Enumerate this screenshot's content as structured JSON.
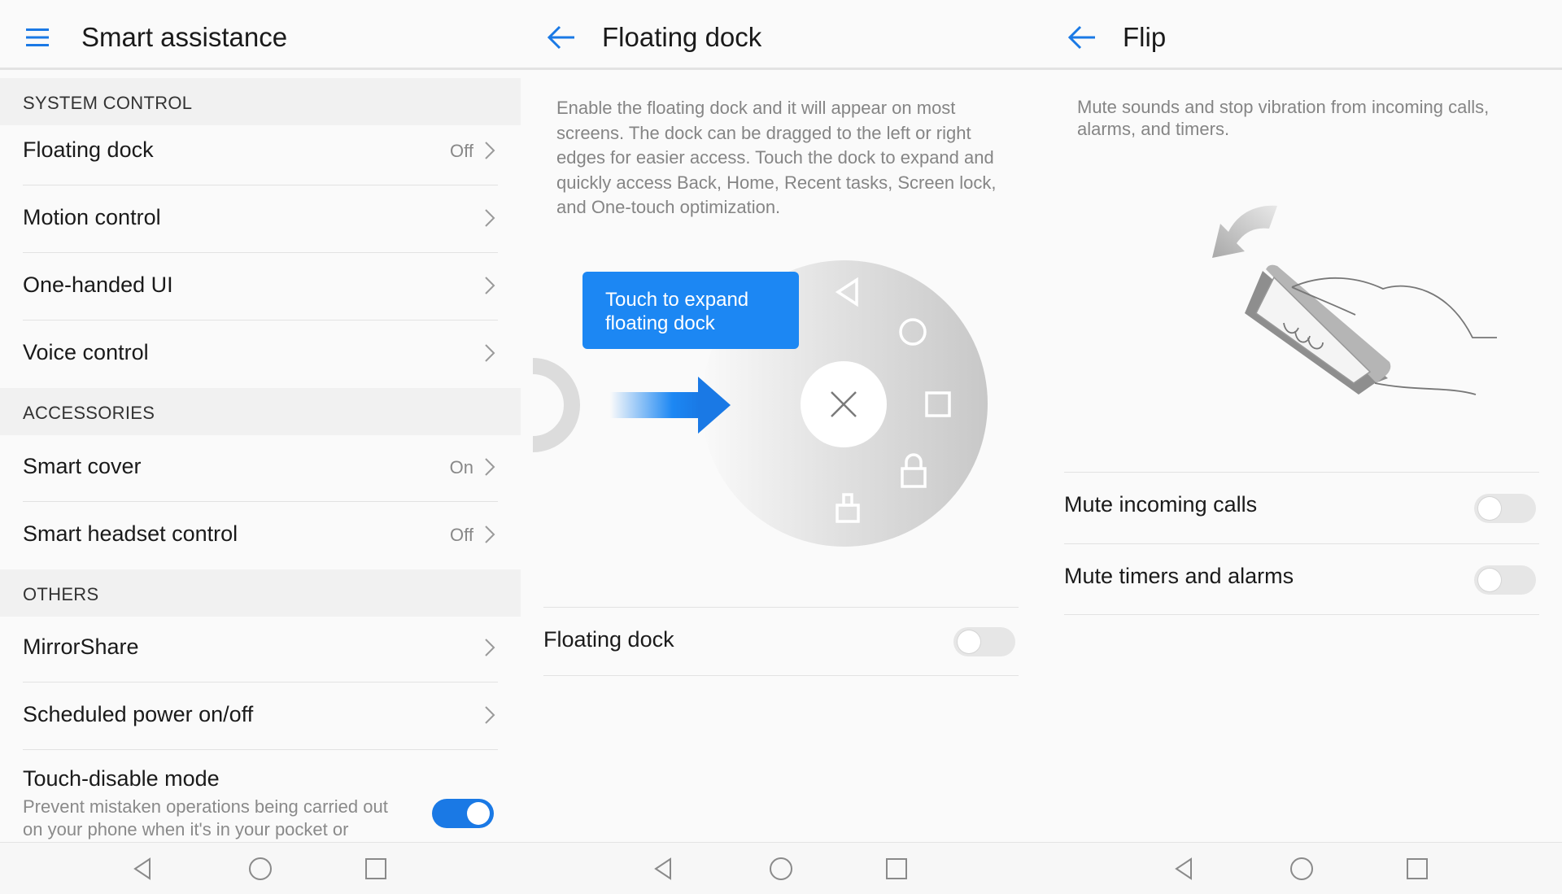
{
  "screen1": {
    "title": "Smart assistance",
    "sections": [
      {
        "header": "SYSTEM CONTROL",
        "items": [
          {
            "label": "Floating dock",
            "value": "Off"
          },
          {
            "label": "Motion control",
            "value": ""
          },
          {
            "label": "One-handed UI",
            "value": ""
          },
          {
            "label": "Voice control",
            "value": ""
          }
        ]
      },
      {
        "header": "ACCESSORIES",
        "items": [
          {
            "label": "Smart cover",
            "value": "On"
          },
          {
            "label": "Smart headset control",
            "value": "Off"
          }
        ]
      },
      {
        "header": "OTHERS",
        "items": [
          {
            "label": "MirrorShare",
            "value": ""
          },
          {
            "label": "Scheduled power on/off",
            "value": ""
          }
        ]
      }
    ],
    "touch_disable": {
      "label": "Touch-disable mode",
      "description": "Prevent mistaken operations being carried out on your phone when it's in your pocket or",
      "enabled": true
    }
  },
  "screen2": {
    "title": "Floating dock",
    "description": "Enable the floating dock and it will appear on most screens. The dock can be dragged to the left or right edges for easier access. Touch the dock to expand and quickly access Back, Home, Recent tasks, Screen lock, and One-touch optimization.",
    "tooltip": "Touch to expand floating dock",
    "setting_label": "Floating dock",
    "setting_enabled": false
  },
  "screen3": {
    "title": "Flip",
    "description": "Mute sounds and stop vibration from incoming calls, alarms, and timers.",
    "settings": [
      {
        "label": "Mute incoming calls",
        "enabled": false
      },
      {
        "label": "Mute timers and alarms",
        "enabled": false
      }
    ]
  },
  "colors": {
    "accent": "#1a79e5",
    "tooltip": "#1c87f3",
    "background": "#fafafa",
    "section_bg": "#f1f1f1"
  },
  "icons": {
    "menu": "hamburger-menu-icon",
    "back": "back-arrow-icon",
    "chevron": "chevron-right-icon",
    "nav_back": "triangle-back-icon",
    "nav_home": "circle-home-icon",
    "nav_recent": "square-recent-icon"
  }
}
